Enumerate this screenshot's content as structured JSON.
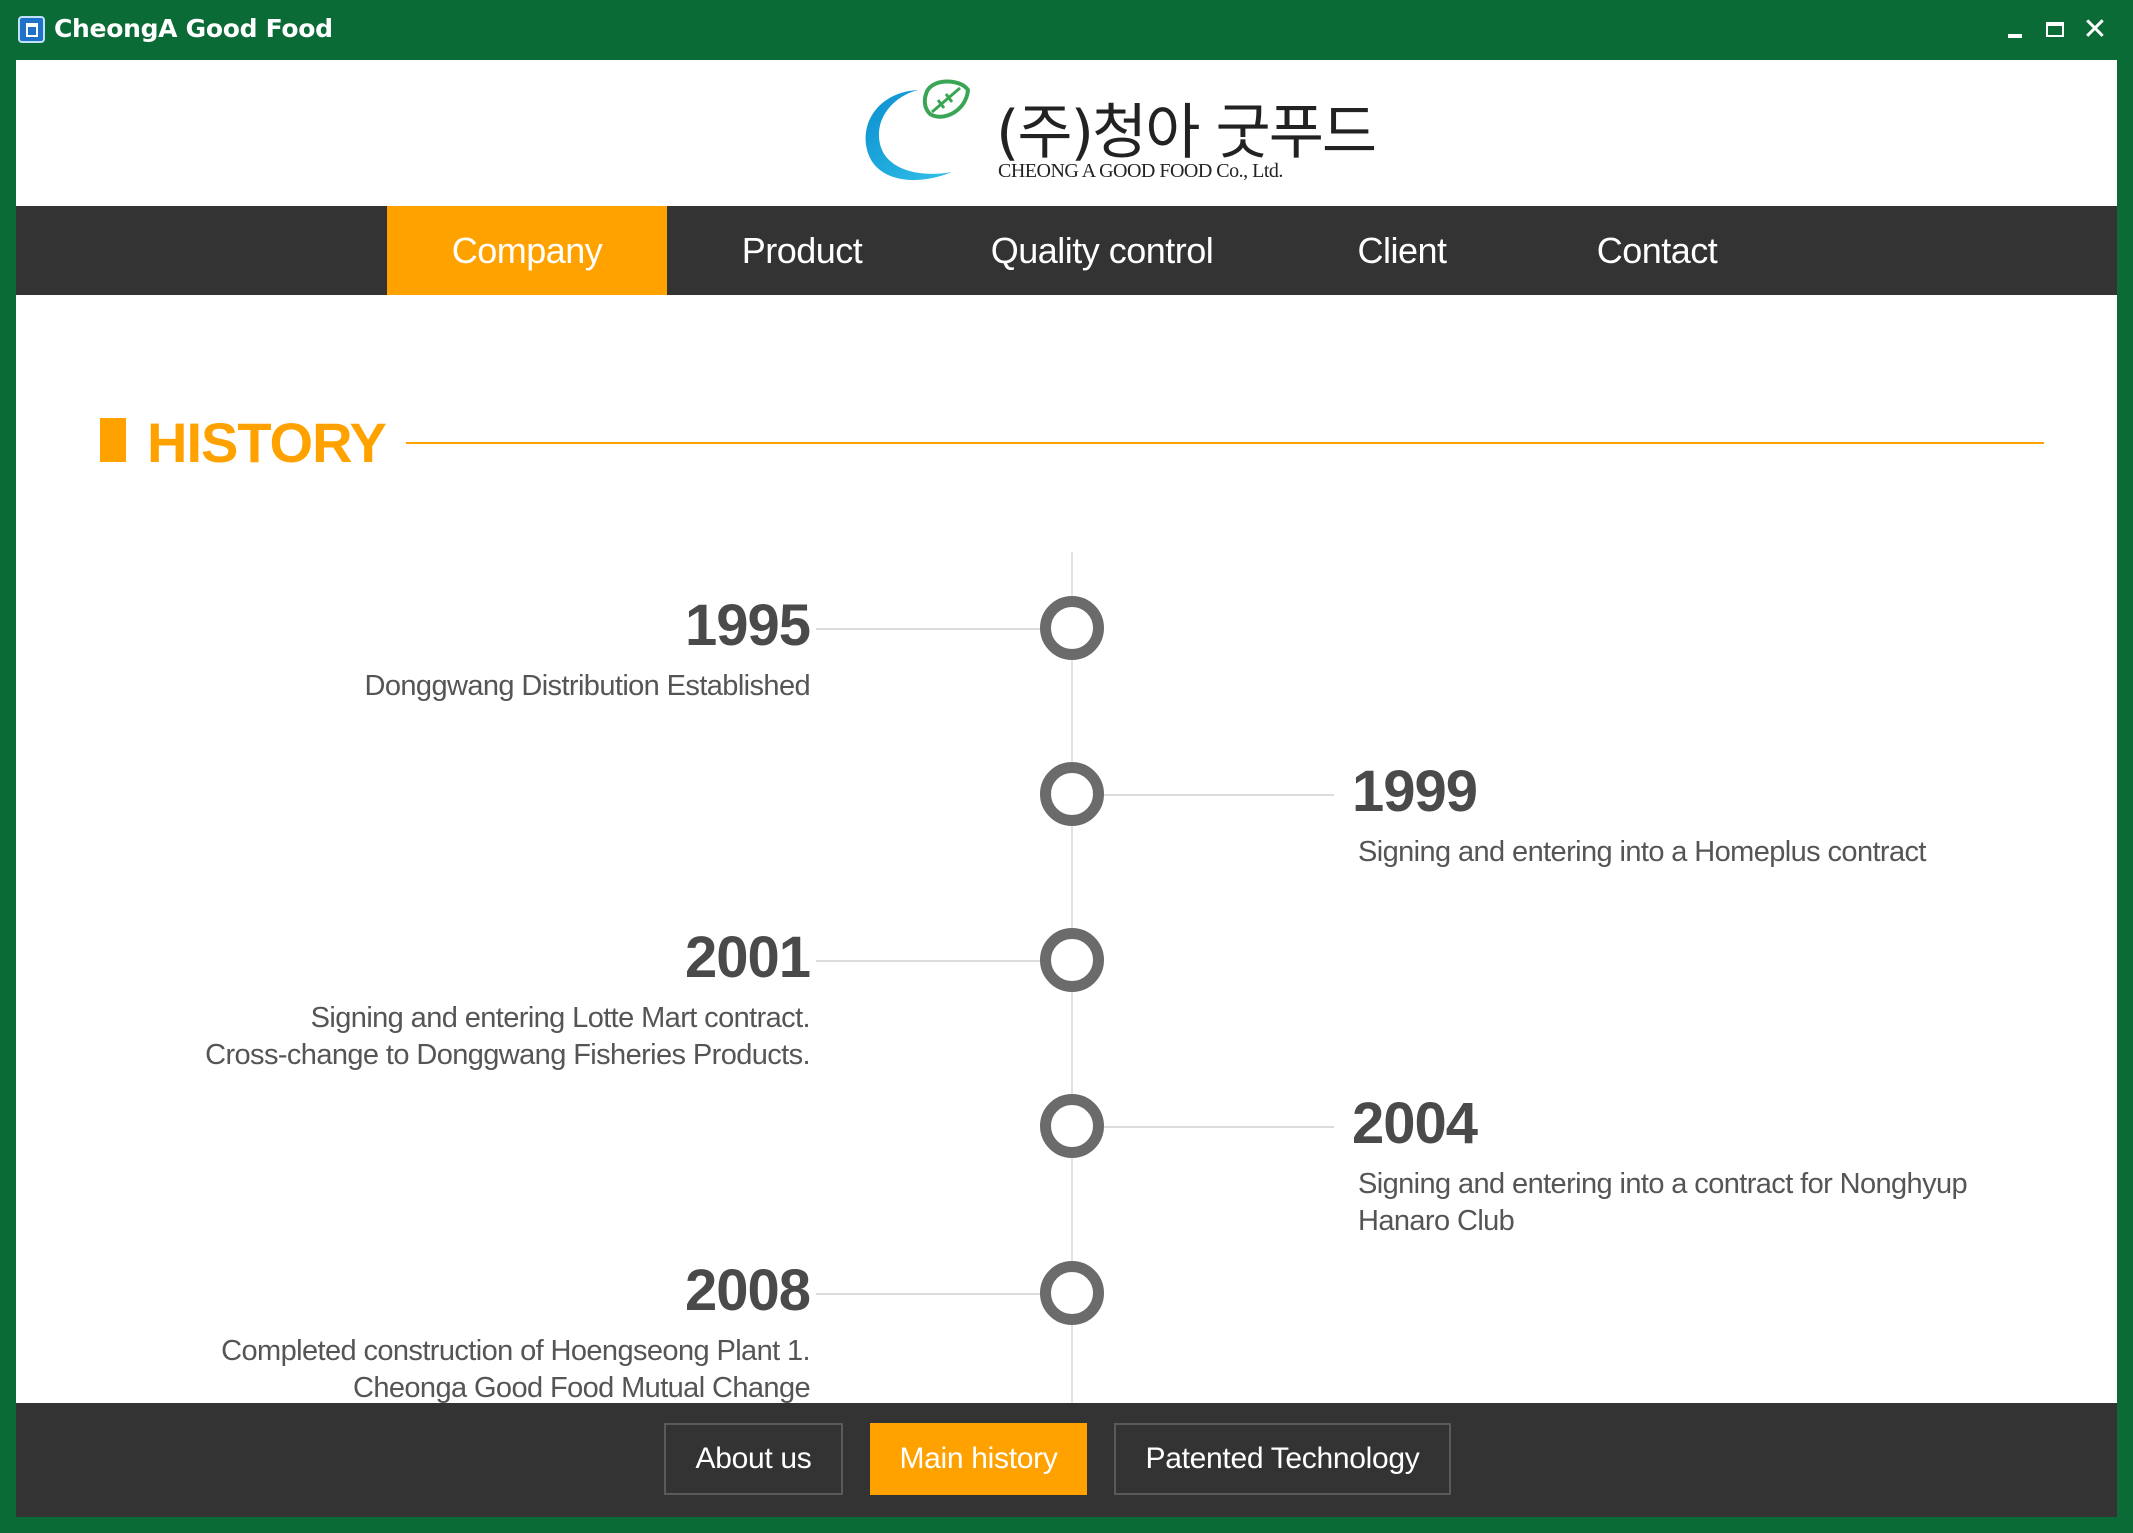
{
  "window": {
    "title": "CheongA Good Food",
    "controls": {
      "minimize": "minimize-icon",
      "maximize": "maximize-icon",
      "close": "✕"
    }
  },
  "header": {
    "logo_korean": "(주)청아 굿푸드",
    "logo_english": "CHEONG A GOOD FOOD Co., Ltd."
  },
  "nav": {
    "items": [
      {
        "label": "Company",
        "active": true
      },
      {
        "label": "Product",
        "active": false
      },
      {
        "label": "Quality control",
        "active": false
      },
      {
        "label": "Client",
        "active": false
      },
      {
        "label": "Contact",
        "active": false
      }
    ]
  },
  "section": {
    "title": "HISTORY"
  },
  "history": [
    {
      "year": "1995",
      "side": "left",
      "lines": [
        "Donggwang Distribution Established"
      ]
    },
    {
      "year": "1999",
      "side": "right",
      "lines": [
        "Signing and entering into a Homeplus contract"
      ]
    },
    {
      "year": "2001",
      "side": "left",
      "lines": [
        "Signing and entering Lotte Mart contract.",
        "Cross-change to Donggwang Fisheries Products."
      ]
    },
    {
      "year": "2004",
      "side": "right",
      "lines": [
        "Signing and entering into a contract for Nonghyup",
        "Hanaro Club"
      ]
    },
    {
      "year": "2008",
      "side": "left",
      "lines": [
        "Completed construction of Hoengseong Plant 1.",
        "Cheonga Good Food Mutual Change"
      ]
    }
  ],
  "subnav": {
    "items": [
      {
        "label": "About us",
        "active": false
      },
      {
        "label": "Main history",
        "active": true
      },
      {
        "label": "Patented Technology",
        "active": false
      }
    ]
  },
  "colors": {
    "frame": "#0b6b37",
    "accent": "#ffa200",
    "dark_bar": "#333333",
    "timeline_circle": "#6b6b6b"
  }
}
